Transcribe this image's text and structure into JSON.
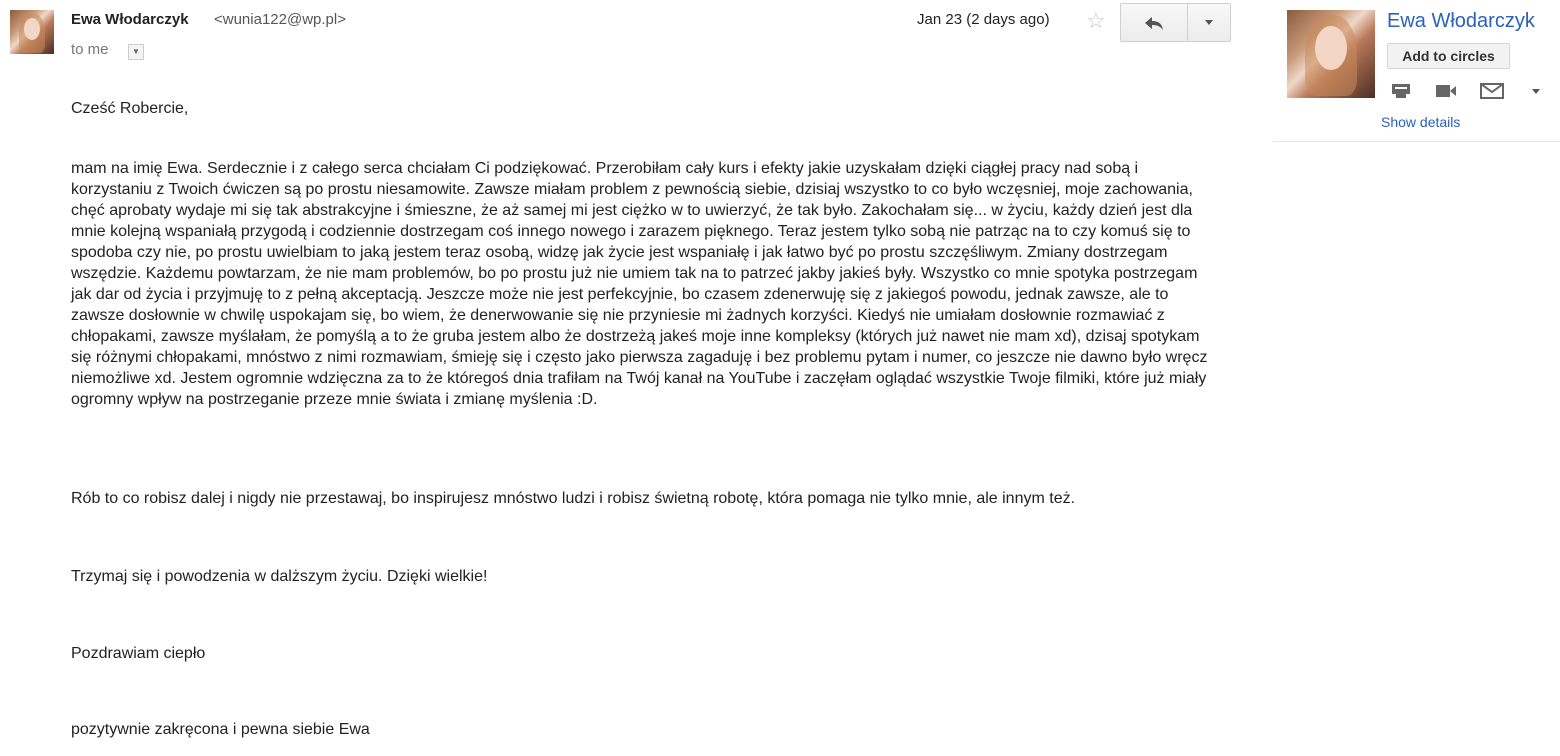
{
  "header": {
    "sender_name": "Ewa Włodarczyk",
    "sender_email": "<wunia122@wp.pl>",
    "recipient": "to me",
    "date": "Jan 23 (2 days ago)",
    "star_glyph": "☆"
  },
  "body": {
    "greeting": "Cześć Robercie,",
    "main": "mam na imię Ewa. Serdecznie i z całego serca chciałam Ci podziękować. Przerobiłam cały kurs i efekty jakie uzyskałam dzięki ciągłej pracy nad sobą i korzystaniu z Twoich ćwiczen są po prostu niesamowite. Zawsze miałam problem z pewnością siebie, dzisiaj wszystko to co było wczęsniej, moje zachowania, chęć aprobaty wydaje mi się tak abstrakcyjne i śmieszne, że aż samej mi jest ciężko w to uwierzyć, że tak było. Zakochałam się... w życiu, każdy dzień jest dla mnie kolejną wspaniałą przygodą i codziennie dostrzegam coś innego nowego i zarazem pięknego. Teraz jestem tylko sobą nie patrząc na to czy komuś się to spodoba czy nie, po prostu uwielbiam to jaką jestem teraz osobą, widzę jak życie jest wspaniałę i jak łatwo być po prostu szczęśliwym. Zmiany dostrzegam wszędzie. Każdemu powtarzam, że nie mam problemów, bo po prostu już nie umiem tak na to patrzeć jakby jakieś były. Wszystko co mnie spotyka postrzegam jak dar od życia i przyjmuję to z pełną akceptacją. Jeszcze może nie jest perfekcyjnie, bo czasem zdenerwuję się z jakiegoś powodu, jednak zawsze, ale to zawsze dosłownie w chwilę uspokajam się, bo wiem, że denerwowanie się nie przyniesie mi żadnych korzyści. Kiedyś nie umiałam dosłownie rozmawiać z chłopakami, zawsze myślałam, że pomyślą a to że gruba jestem albo że dostrzeżą jakeś moje inne kompleksy (których już nawet  nie mam xd), dzisaj spotykam się różnymi chłopakami, mnóstwo z nimi rozmawiam, śmieję się i często jako pierwsza zagaduję i bez problemu pytam i numer, co jeszcze nie dawno było wręcz niemożliwe xd. Jestem ogromnie wdzięczna za to że któregoś dnia trafiłam na Twój kanał na YouTube i zaczęłam oglądać wszystkie Twoje filmiki, które już miały ogromny wpływ na postrzeganie przeze mnie świata i zmianę myślenia :D.",
    "keep_going": "Rób to co robisz dalej i nigdy nie przestawaj, bo inspirujesz mnóstwo ludzi i robisz świetną robotę, która pomaga nie tylko mnie, ale innym też.",
    "hold_on": "Trzymaj się i powodzenia w dalższym życiu. Dzięki wielkie!",
    "regards": "Pozdrawiam ciepło",
    "signature": "pozytywnie zakręcona i pewna siebie Ewa"
  },
  "panel": {
    "name": "Ewa Włodarczyk",
    "add_to_circles": "Add to circles",
    "show_details": "Show details"
  },
  "colors": {
    "link": "#2962b9",
    "text": "#222222"
  },
  "icons": [
    "reply-icon",
    "chevron-down-icon",
    "star-icon",
    "chat-icon",
    "video-icon",
    "mail-icon"
  ]
}
